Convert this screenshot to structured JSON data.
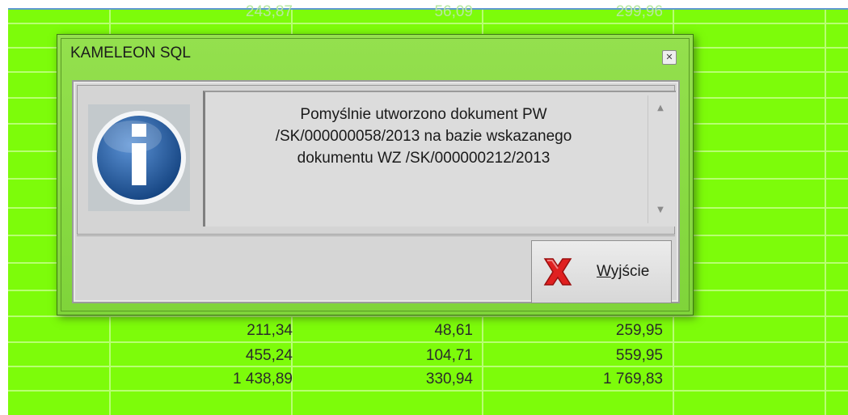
{
  "dialog": {
    "title": "KAMELEON SQL",
    "close_glyph": "✕",
    "message_line1": "Pomyślnie utworzono dokument PW",
    "message_line2": "/SK/000000058/2013 na bazie wskazanego",
    "message_line3": "dokumentu WZ /SK/000000212/2013",
    "info_icon": "info-icon",
    "exit_button": {
      "mnemonic": "W",
      "rest": "yjście",
      "icon": "red-x-icon"
    },
    "scroll_up_glyph": "▲",
    "scroll_down_glyph": "▼"
  },
  "grid": {
    "top_row": [
      "243,87",
      "56,09",
      "299,96"
    ],
    "rows": [
      [
        "211,34",
        "48,61",
        "259,95"
      ],
      [
        "455,24",
        "104,71",
        "559,95"
      ],
      [
        "1 438,89",
        "330,94",
        "1 769,83"
      ]
    ]
  },
  "colors": {
    "grid_bg": "#7dfc0a",
    "dialog_frame": "#8fdc4a",
    "exit_icon": "#e02020"
  }
}
